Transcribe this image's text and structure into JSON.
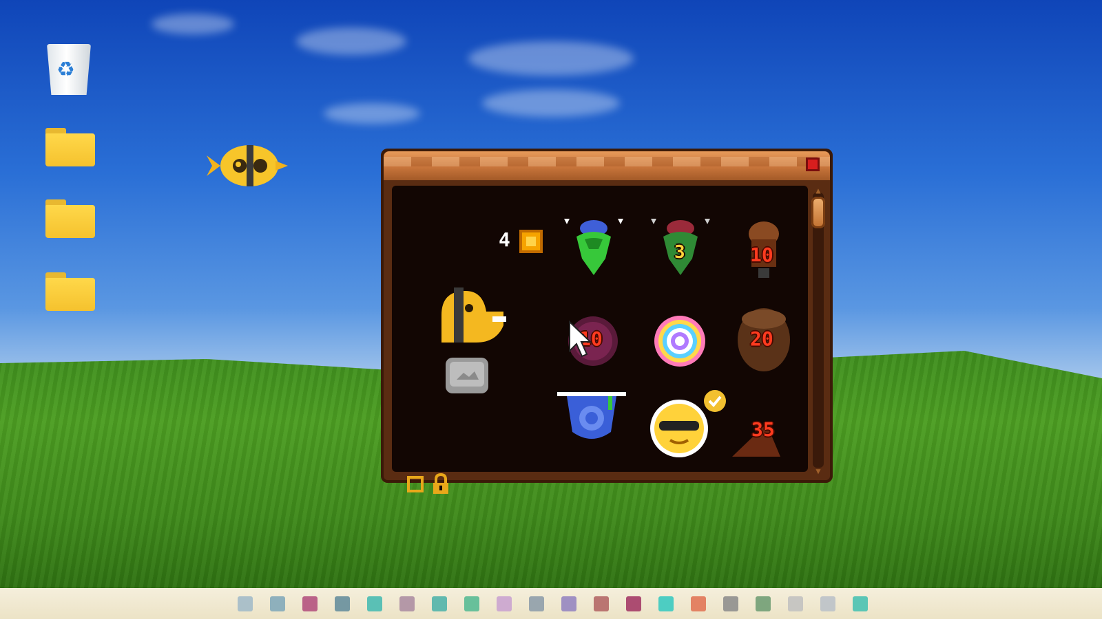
{
  "desktop": {
    "icons": [
      "recycle-bin-icon",
      "folder-icon",
      "folder-icon",
      "folder-icon"
    ]
  },
  "game": {
    "coin_count": "4",
    "items": [
      {
        "name": "green-mask",
        "label": ""
      },
      {
        "name": "goblin-mask",
        "label": "3"
      },
      {
        "name": "brown-totem",
        "label": "10"
      },
      {
        "name": "purple-orb",
        "label": "10"
      },
      {
        "name": "rainbow-swirl",
        "label": ""
      },
      {
        "name": "tree-stump",
        "label": "20"
      },
      {
        "name": "blue-swirl-pot",
        "label": ""
      },
      {
        "name": "sunglasses-smiley",
        "label": ""
      },
      {
        "name": "pizza-slice",
        "label": "35"
      }
    ]
  },
  "colors": {
    "panel_bg": "#120603",
    "frame": "#5a2c12",
    "accent": "#f6a300",
    "price_red": "#ff3b1f"
  },
  "taskbar": {
    "item_colors": [
      "#9fb8c8",
      "#7da6b8",
      "#b04a7a",
      "#5f8a9a",
      "#3fb8b0",
      "#a98aa0",
      "#48b0a8",
      "#50b890",
      "#c8a0d0",
      "#8a9aa8",
      "#9080c0",
      "#b06060",
      "#a03060",
      "#30c8c0",
      "#e07050",
      "#8a8a8a",
      "#6a9a70",
      "#c0c0c0",
      "#b8c0c8",
      "#40c0b0"
    ]
  }
}
